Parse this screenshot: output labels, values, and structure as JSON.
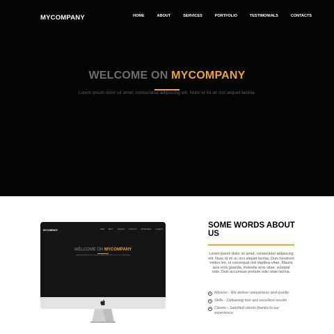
{
  "header": {
    "logo": "MYCOMPANY",
    "nav": [
      "HOME",
      "ABOUT",
      "SERVICES",
      "PORTFOLIO",
      "TESTIMONIALS",
      "CONTACTS"
    ]
  },
  "hero": {
    "title_prefix": "WELCOME ON",
    "title_highlight": "MYCOMPANY",
    "subtitle": "Lorem ipsum dolor sit amet, consectetur adipiscing elit. Nunc id mi ac orci aliquet lacinia."
  },
  "mockup": {
    "logo": "MYCOMPANY",
    "nav": [
      "HOME",
      "ABOUT",
      "SERVICES",
      "PORTFOLIO",
      "TESTIMONIALS",
      "CONTACTS"
    ],
    "title_prefix": "WELCOME ON",
    "title_highlight": "MYCOMPANY",
    "subtitle": "Lorem ipsum dolor sit amet, consectetur adipiscing elit. Nunc id mi ac orci aliquet lacinia."
  },
  "about": {
    "title": "SOME WORDS ABOUT US",
    "body": "Lorem ipsum dolor sit amet, consectetur adipiscing elit. Nunc id mi ac orci aliquet lacinia. Duis hendrerit metus leo, ut consequat nisl dapibus vitae. Mauris quis eros gravida, molestie eros vitae, volutpat odio. Duis accumsan pretium odio vitae lacinia.",
    "bullets": [
      "Mission - We deliver uniqueness and quality",
      "Skills - Delivering fast and excellent results",
      "Clients - Satisfied clients thanks to our experience"
    ]
  },
  "colors": {
    "accent": "#f2a32a",
    "hero_bg": "#050505"
  }
}
